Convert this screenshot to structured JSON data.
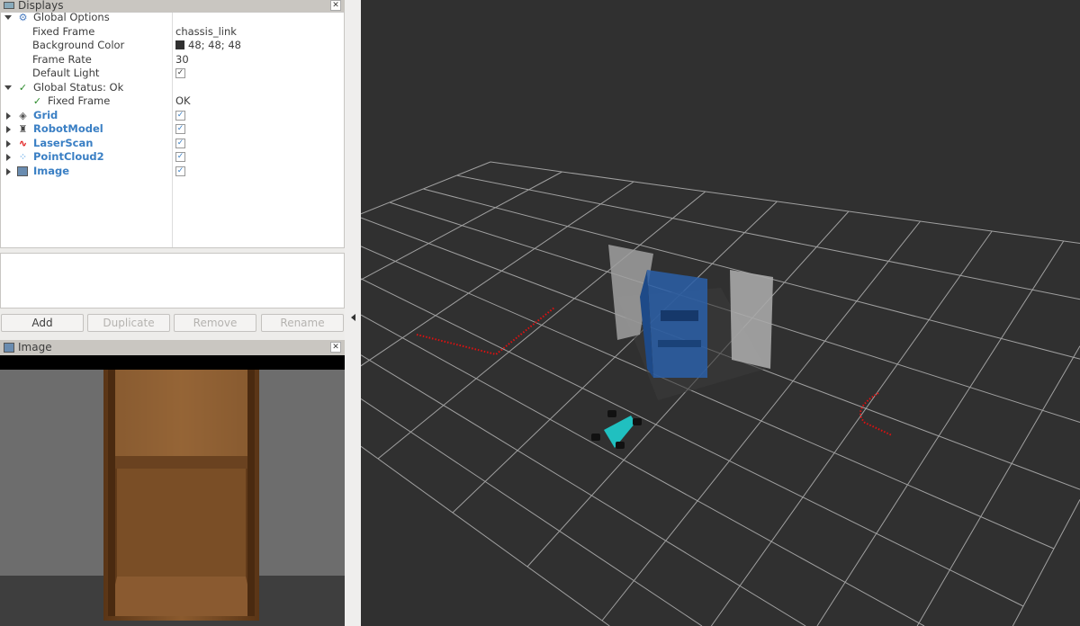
{
  "displays_panel": {
    "title": "Displays",
    "rows": [
      {
        "label": "Global Options",
        "value": "",
        "icon": "gear-icon"
      },
      {
        "label": "Fixed Frame",
        "value": "chassis_link"
      },
      {
        "label": "Background Color",
        "value": "48; 48; 48",
        "swatch": "#303030"
      },
      {
        "label": "Frame Rate",
        "value": "30"
      },
      {
        "label": "Default Light",
        "checked": true
      },
      {
        "label": "Global Status: Ok",
        "icon": "check-icon"
      },
      {
        "label": "Fixed Frame",
        "value": "OK",
        "icon": "check-icon"
      },
      {
        "label": "Grid",
        "checked": true,
        "icon": "grid-icon"
      },
      {
        "label": "RobotModel",
        "checked": true,
        "icon": "robot-icon"
      },
      {
        "label": "LaserScan",
        "checked": true,
        "icon": "laserscan-icon"
      },
      {
        "label": "PointCloud2",
        "checked": true,
        "icon": "pointcloud-icon"
      },
      {
        "label": "Image",
        "checked": true,
        "icon": "image-icon"
      }
    ],
    "buttons": {
      "add": "Add",
      "duplicate": "Duplicate",
      "remove": "Remove",
      "rename": "Rename"
    }
  },
  "image_panel": {
    "title": "Image"
  },
  "colors": {
    "background": "#303030",
    "accent": "#3a7fc4",
    "laser": "#e01010",
    "robot": "#20c0c0",
    "pointcloud": "#2a5fa8"
  }
}
